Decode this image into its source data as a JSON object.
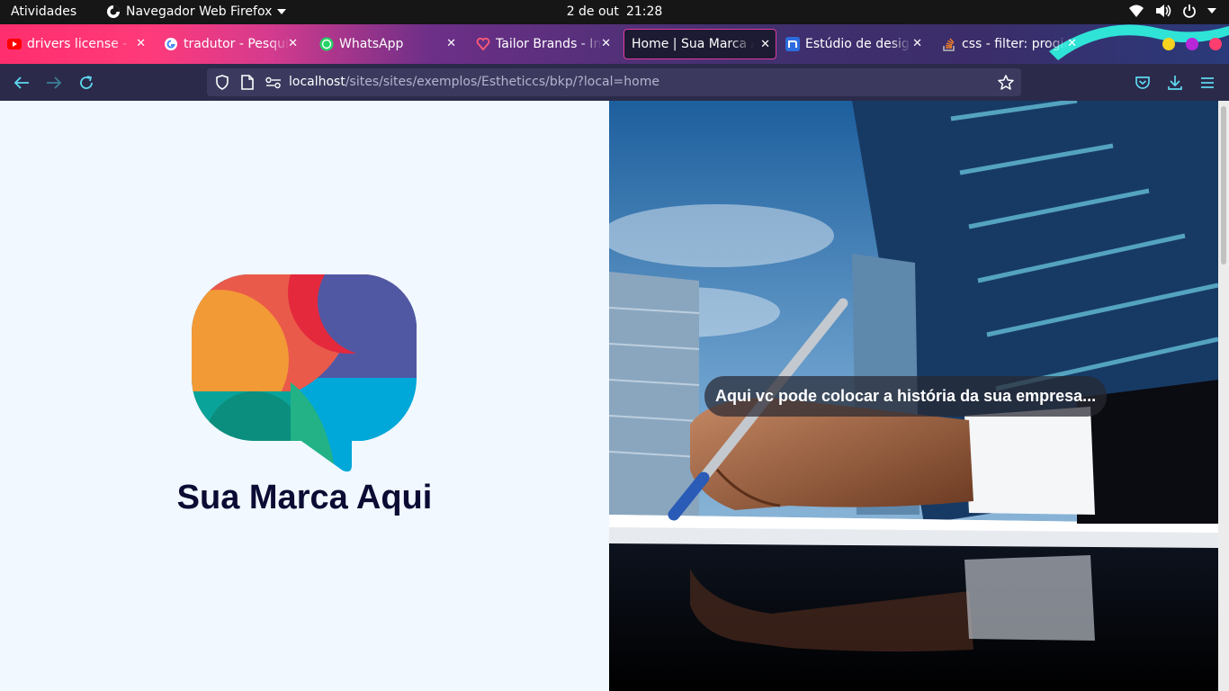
{
  "system": {
    "activities": "Atividades",
    "app_name": "Navegador Web Firefox",
    "date": "2 de out",
    "time": "21:28"
  },
  "tabs": [
    {
      "title": "drivers license - O",
      "icon": "youtube-icon",
      "active": false
    },
    {
      "title": "tradutor - Pesquisa",
      "icon": "google-icon",
      "active": false
    },
    {
      "title": "WhatsApp",
      "icon": "whatsapp-icon",
      "active": false
    },
    {
      "title": "Tailor Brands - Ins",
      "icon": "tailor-brands-icon",
      "active": false
    },
    {
      "title": "Home | Sua Marca Aq",
      "icon": "page-icon",
      "active": true
    },
    {
      "title": "Estúdio de design",
      "icon": "n-icon",
      "active": false
    },
    {
      "title": "css - filter: progid",
      "icon": "stackoverflow-icon",
      "active": false
    }
  ],
  "address": {
    "host": "localhost",
    "path": "/sites/sites/exemplos/Estheticcs/bkp/?local=home"
  },
  "page": {
    "brand_name": "Sua Marca Aqui",
    "hero_caption": "Aqui vc pode colocar a história da sua empresa..."
  },
  "colors": {
    "accent": "#e13a9d",
    "brand_text": "#0b0b33",
    "page_bg": "#f1f8ff"
  }
}
